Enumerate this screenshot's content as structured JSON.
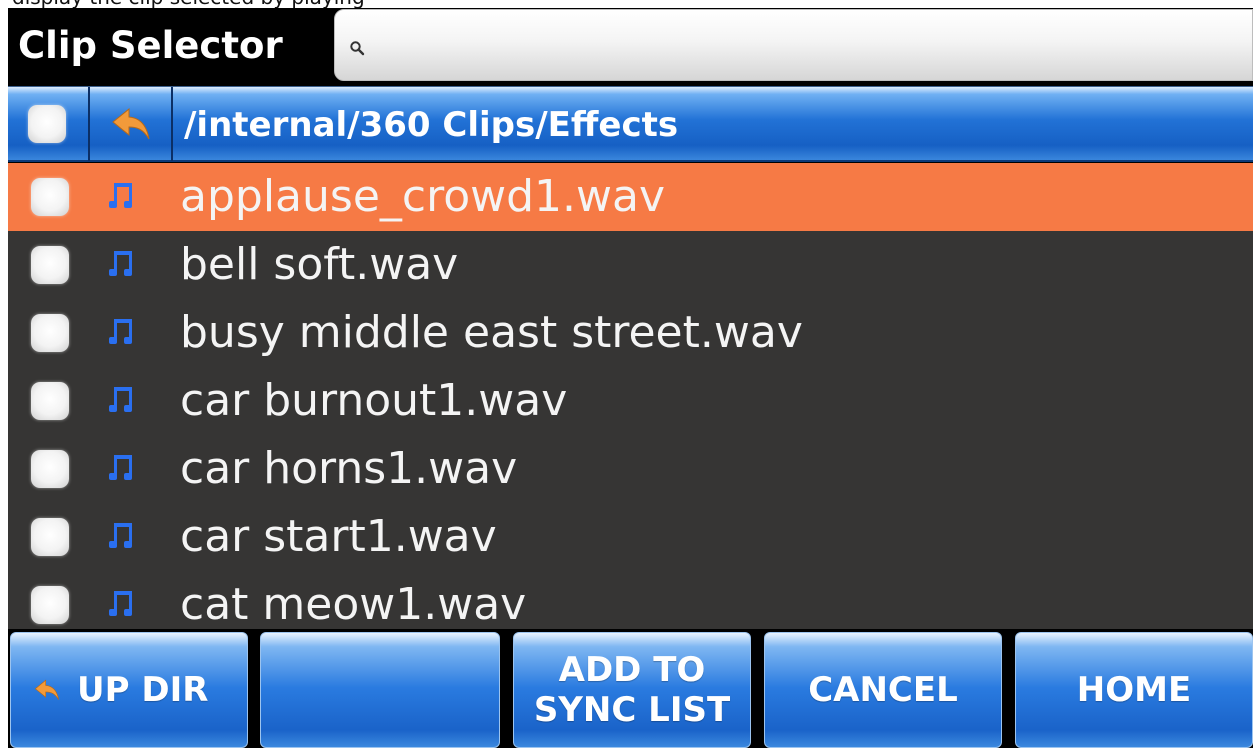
{
  "top_strip_text": "display the clip selected by playing",
  "header": {
    "title": "Clip Selector",
    "search_placeholder": "",
    "search_value": ""
  },
  "path_bar": {
    "path": "/internal/360 Clips/Effects"
  },
  "files": [
    {
      "name": "applause_crowd1.wav",
      "selected": true
    },
    {
      "name": "bell soft.wav",
      "selected": false
    },
    {
      "name": "busy middle east street.wav",
      "selected": false
    },
    {
      "name": "car burnout1.wav",
      "selected": false
    },
    {
      "name": "car horns1.wav",
      "selected": false
    },
    {
      "name": "car start1.wav",
      "selected": false
    },
    {
      "name": "cat meow1.wav",
      "selected": false
    }
  ],
  "buttons": {
    "up_dir": "UP DIR",
    "blank": "",
    "add_to_sync_line1": "ADD TO",
    "add_to_sync_line2": "SYNC LIST",
    "cancel": "CANCEL",
    "home": "HOME"
  },
  "icons": {
    "back_arrow": "back-arrow-icon",
    "music_note": "music-note-icon",
    "search": "search-icon"
  },
  "colors": {
    "selected_row": "#f67a45",
    "list_background": "#363534",
    "accent_blue": "#1f6fd6",
    "back_arrow_orange": "#f29a3a",
    "note_blue": "#2a6ff0"
  }
}
